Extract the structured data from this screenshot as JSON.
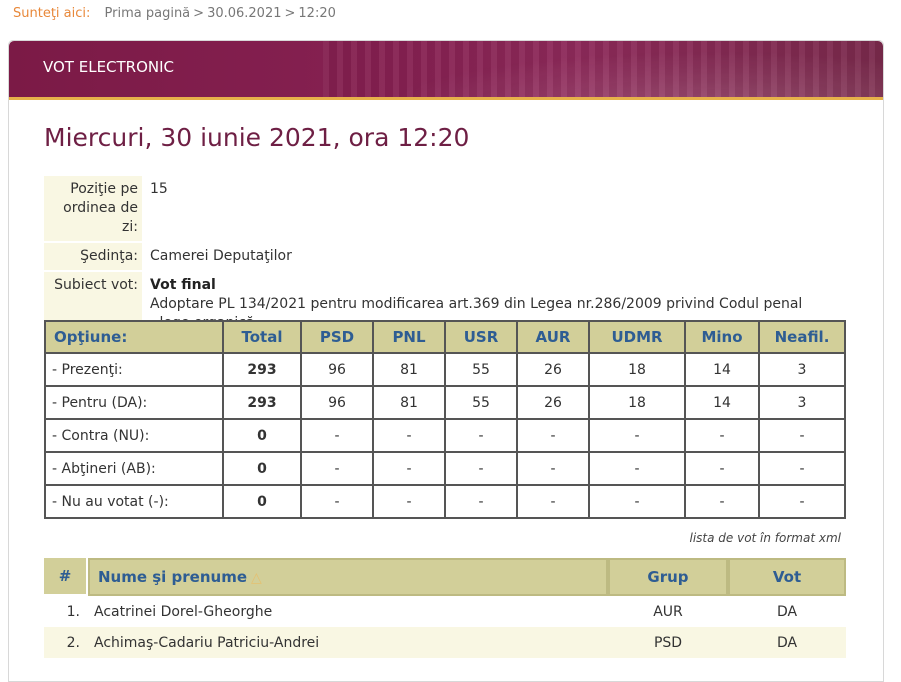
{
  "breadcrumb": {
    "here_label": "Sunteţi aici:",
    "items": [
      "Prima pagină",
      "30.06.2021",
      "12:20"
    ]
  },
  "banner": {
    "title": "VOT ELECTRONIC"
  },
  "heading": "Miercuri, 30 iunie 2021, ora 12:20",
  "info": {
    "position_label": "Poziţie pe ordinea de zi:",
    "position_value": "15",
    "session_label": "Şedinţa:",
    "session_value": "Camerei Deputaţilor",
    "subject_label": "Subiect vot:",
    "subject_title": "Vot final",
    "subject_line1": "Adoptare PL 134/2021 pentru modificarea art.369 din Legea nr.286/2009 privind Codul penal",
    "subject_line2": "- lege organică"
  },
  "stats": {
    "headers": [
      "Opţiune:",
      "Total",
      "PSD",
      "PNL",
      "USR",
      "AUR",
      "UDMR",
      "Mino",
      "Neafil."
    ],
    "rows": [
      [
        "- Prezenţi:",
        "293",
        "96",
        "81",
        "55",
        "26",
        "18",
        "14",
        "3"
      ],
      [
        "- Pentru (DA):",
        "293",
        "96",
        "81",
        "55",
        "26",
        "18",
        "14",
        "3"
      ],
      [
        "- Contra (NU):",
        "0",
        "-",
        "-",
        "-",
        "-",
        "-",
        "-",
        "-"
      ],
      [
        "- Abţineri (AB):",
        "0",
        "-",
        "-",
        "-",
        "-",
        "-",
        "-",
        "-"
      ],
      [
        "- Nu au votat (-):",
        "0",
        "-",
        "-",
        "-",
        "-",
        "-",
        "-",
        "-"
      ]
    ]
  },
  "xml_link": "lista de vot în format xml",
  "names_table": {
    "headers": {
      "num": "#",
      "name": "Nume şi prenume",
      "group": "Grup",
      "vote": "Vot"
    },
    "sort_icon": "triangle-up-icon",
    "rows": [
      {
        "num": "1.",
        "name": "Acatrinei Dorel-Gheorghe",
        "group": "AUR",
        "vote": "DA"
      },
      {
        "num": "2.",
        "name": "Achimaş-Cadariu Patriciu-Andrei",
        "group": "PSD",
        "vote": "DA"
      }
    ]
  },
  "colors": {
    "banner": "#862152",
    "accent_gold": "#e6b14a",
    "header_bg": "#d2cf99",
    "header_text": "#2e5d93",
    "heading_text": "#6e1f44"
  }
}
